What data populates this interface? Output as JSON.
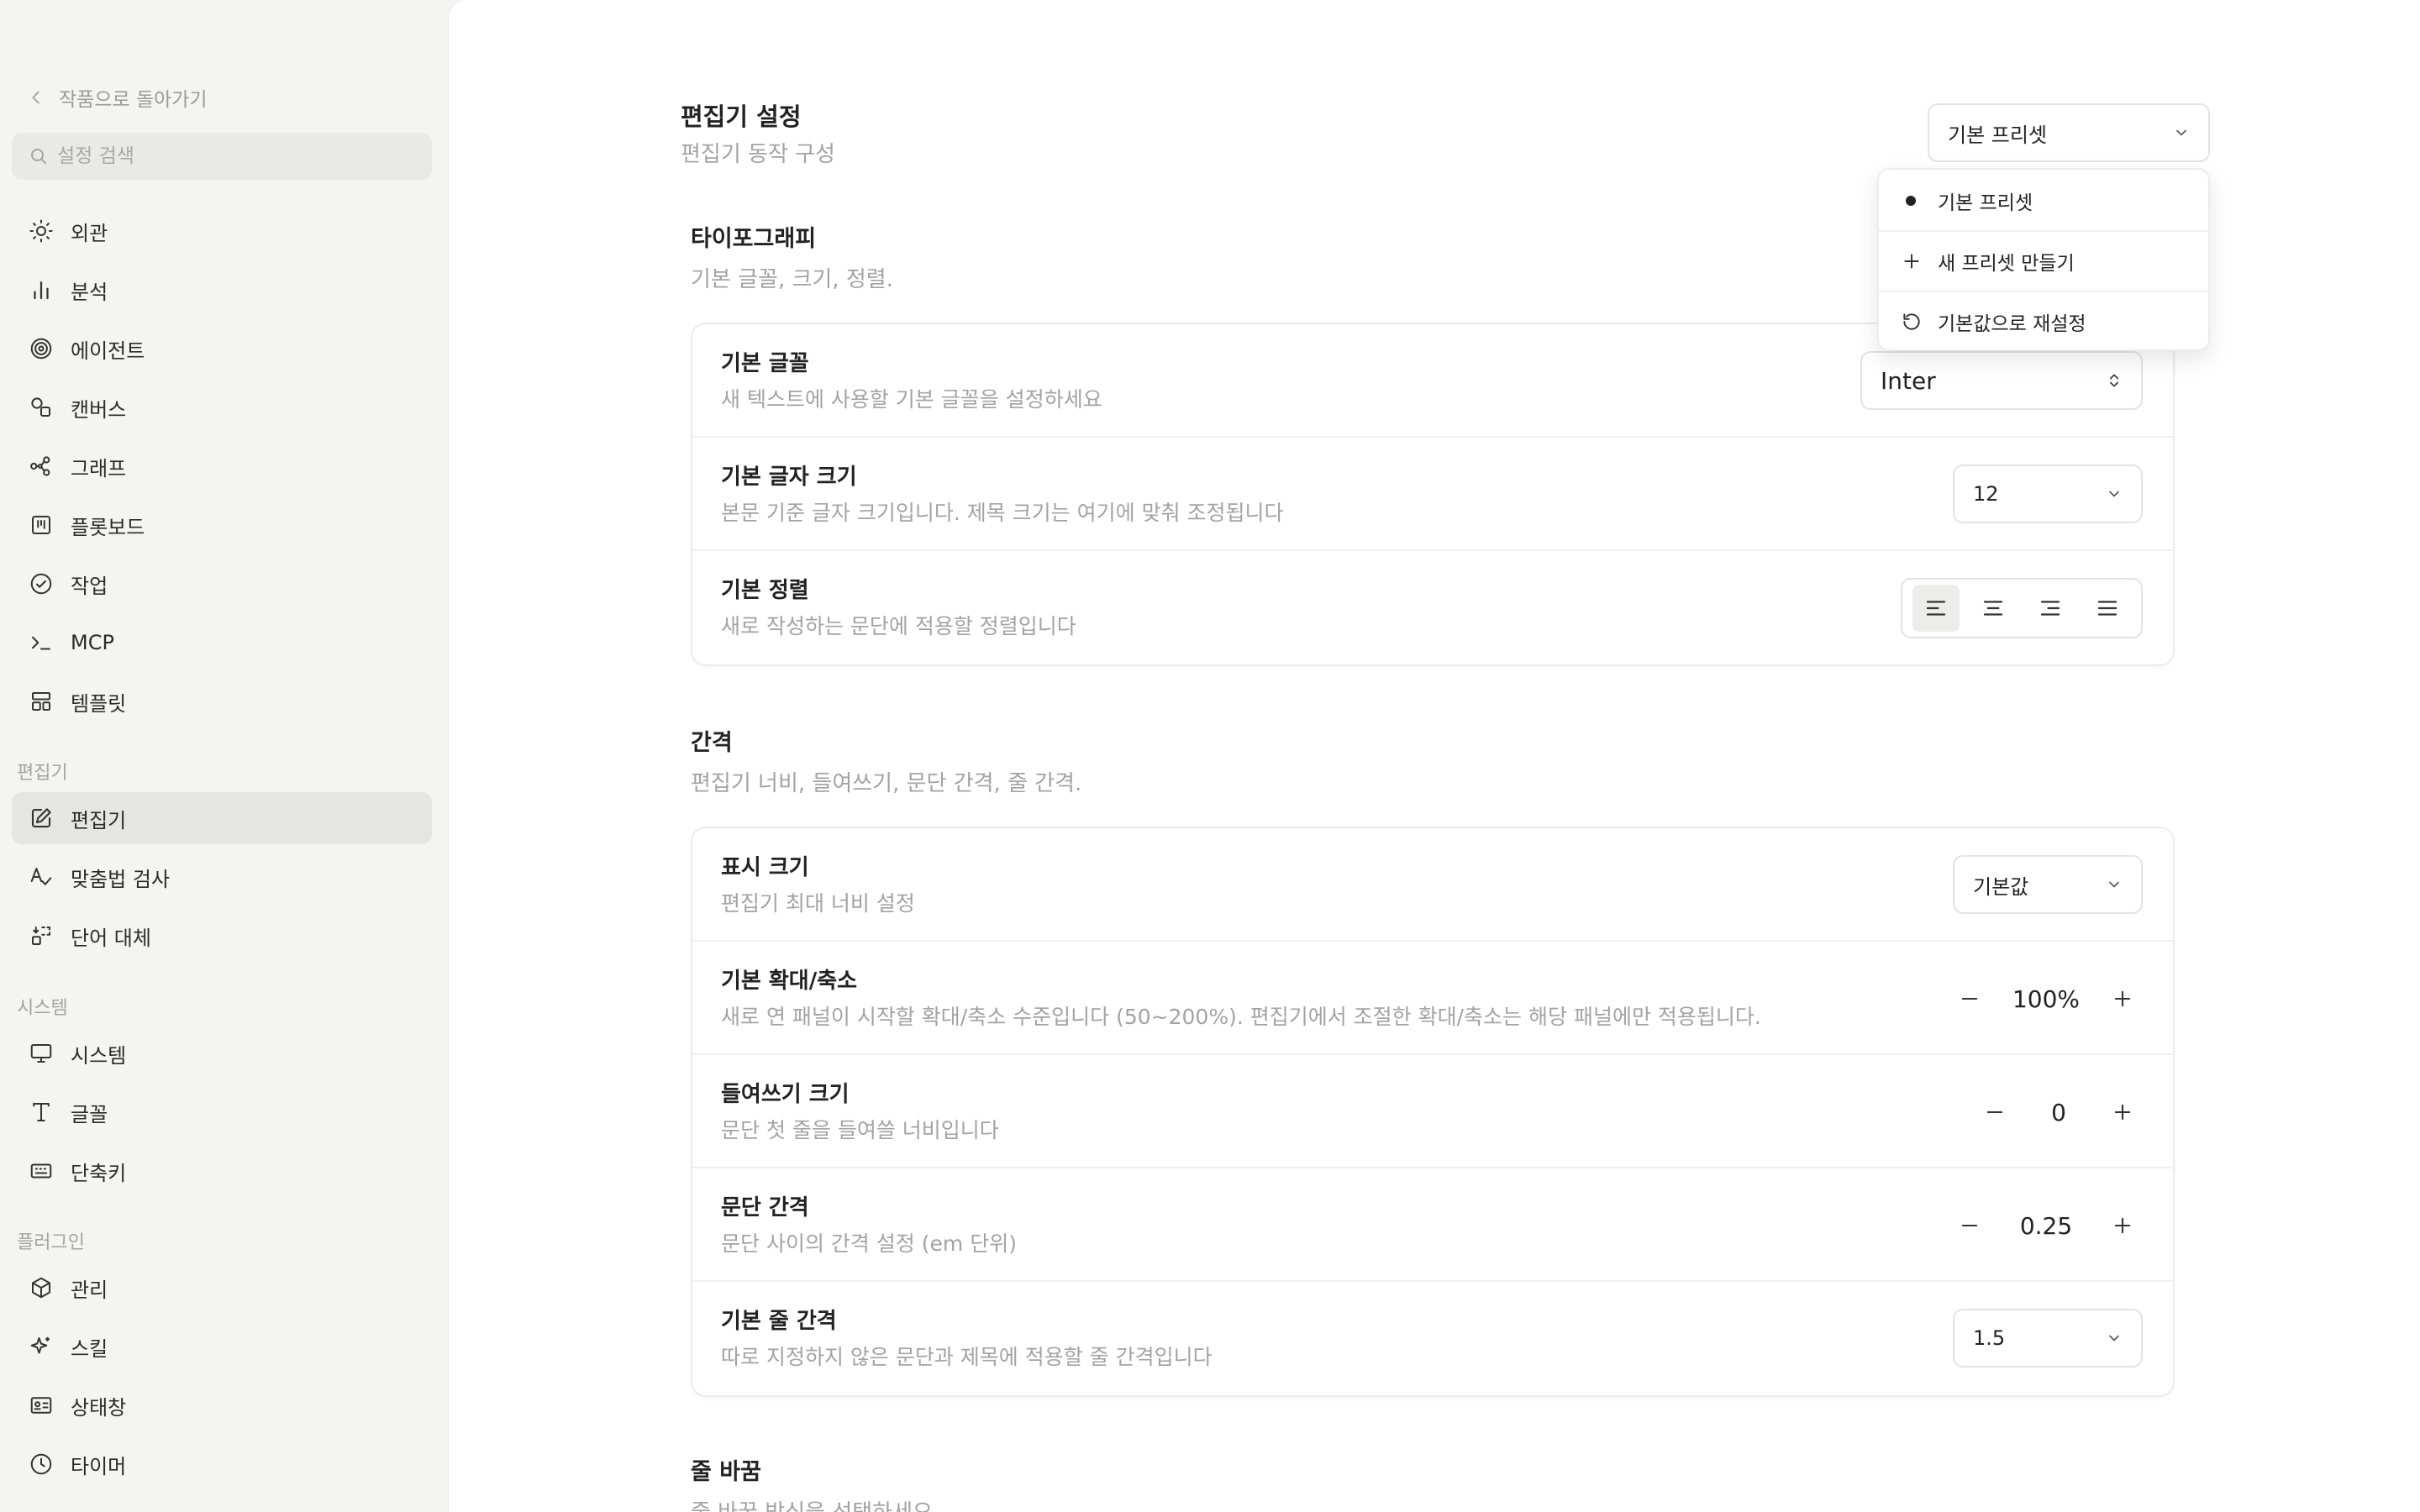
{
  "sidebar": {
    "back_label": "작품으로 돌아가기",
    "search_placeholder": "설정 검색",
    "items": [
      {
        "label": "외관",
        "icon": "sun-icon"
      },
      {
        "label": "분석",
        "icon": "bar-chart-icon"
      },
      {
        "label": "에이전트",
        "icon": "spiral-icon"
      },
      {
        "label": "캔버스",
        "icon": "shapes-icon"
      },
      {
        "label": "그래프",
        "icon": "graph-icon"
      },
      {
        "label": "플롯보드",
        "icon": "board-icon"
      },
      {
        "label": "작업",
        "icon": "check-circle-icon"
      },
      {
        "label": "MCP",
        "icon": "terminal-icon"
      },
      {
        "label": "템플릿",
        "icon": "template-icon"
      }
    ],
    "sections": {
      "editor": {
        "label": "편집기",
        "items": [
          {
            "label": "편집기",
            "icon": "edit-icon",
            "active": true
          },
          {
            "label": "맞춤법 검사",
            "icon": "spellcheck-icon"
          },
          {
            "label": "단어 대체",
            "icon": "replace-icon"
          }
        ]
      },
      "system": {
        "label": "시스템",
        "items": [
          {
            "label": "시스템",
            "icon": "monitor-icon"
          },
          {
            "label": "글꼴",
            "icon": "type-icon"
          },
          {
            "label": "단축키",
            "icon": "keyboard-icon"
          }
        ]
      },
      "plugins": {
        "label": "플러그인",
        "items": [
          {
            "label": "관리",
            "icon": "package-icon"
          },
          {
            "label": "스킬",
            "icon": "sparkle-icon"
          },
          {
            "label": "상태창",
            "icon": "id-card-icon"
          },
          {
            "label": "타이머",
            "icon": "clock-icon"
          }
        ]
      }
    }
  },
  "header": {
    "title": "편집기 설정",
    "subtitle": "편집기 동작 구성",
    "preset_value": "기본 프리셋"
  },
  "preset_menu": {
    "items": [
      {
        "label": "기본 프리셋",
        "icon": "bullet-icon",
        "selected": true
      },
      {
        "label": "새 프리셋 만들기",
        "icon": "plus-icon"
      },
      {
        "label": "기본값으로 재설정",
        "icon": "reset-icon"
      }
    ]
  },
  "typography": {
    "title": "타이포그래피",
    "subtitle": "기본 글꼴, 크기, 정렬.",
    "font": {
      "title": "기본 글꼴",
      "desc": "새 텍스트에 사용할 기본 글꼴을 설정하세요",
      "value": "Inter"
    },
    "size": {
      "title": "기본 글자 크기",
      "desc": "본문 기준 글자 크기입니다. 제목 크기는 여기에 맞춰 조정됩니다",
      "value": "12"
    },
    "align": {
      "title": "기본 정렬",
      "desc": "새로 작성하는 문단에 적용할 정렬입니다",
      "selected": "left"
    }
  },
  "spacing": {
    "title": "간격",
    "subtitle": "편집기 너비, 들여쓰기, 문단 간격, 줄 간격.",
    "display": {
      "title": "표시 크기",
      "desc": "편집기 최대 너비 설정",
      "value": "기본값"
    },
    "zoom": {
      "title": "기본 확대/축소",
      "desc": "새로 연 패널이 시작할 확대/축소 수준입니다 (50~200%). 편집기에서 조절한 확대/축소는 해당 패널에만 적용됩니다.",
      "value": "100%"
    },
    "indent": {
      "title": "들여쓰기 크기",
      "desc": "문단 첫 줄을 들여쓸 너비입니다",
      "value": "0"
    },
    "paragraph": {
      "title": "문단 간격",
      "desc": "문단 사이의 간격 설정 (em 단위)",
      "value": "0.25"
    },
    "line": {
      "title": "기본 줄 간격",
      "desc": "따로 지정하지 않은 문단과 제목에 적용할 줄 간격입니다",
      "value": "1.5"
    }
  },
  "wrap": {
    "title": "줄 바꿈",
    "subtitle": "줄 바꿈 방식을 선택하세요"
  }
}
